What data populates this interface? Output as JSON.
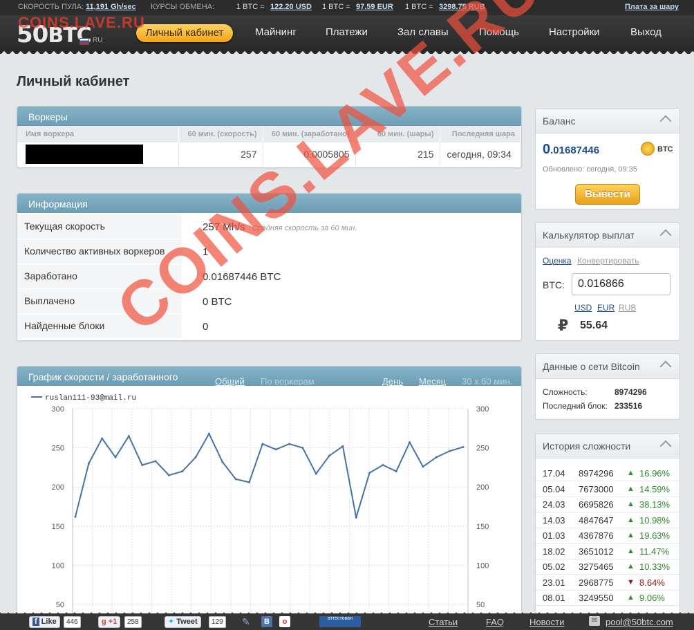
{
  "topbar": {
    "pool_speed_label": "СКОРОСТЬ ПУЛА:",
    "pool_speed_value": "11,191 Gh/sec",
    "rates_label": "КУРСЫ ОБМЕНА:",
    "rate1_prefix": "1 BTC =",
    "rate1_value": "122.20 USD",
    "rate2_prefix": "1 BTC =",
    "rate2_value": "97.59 EUR",
    "rate3_prefix": "1 BTC =",
    "rate3_value": "3298.75 RUB",
    "pay_per_share": "Плата за шару"
  },
  "header": {
    "logo_num": "50",
    "logo_text": "BTC",
    "lang": "RU",
    "nav": [
      "Личный кабинет",
      "Майнинг",
      "Платежи",
      "Зал славы",
      "Помощь",
      "Настройки",
      "Выход"
    ]
  },
  "watermark": {
    "top": "COINS.LAVE.RU",
    "diagonal": "COINS.LAVE.RU"
  },
  "page_title": "Личный кабинет",
  "workers": {
    "title": "Воркеры",
    "columns": [
      "Имя воркера",
      "60 мин. (скорость)",
      "60 мин. (заработано)",
      "60 мин. (шары)",
      "Последняя шара"
    ],
    "row": {
      "speed": "257",
      "earned": "0.0005805",
      "shares": "215",
      "last_share": "сегодня, 09:34"
    }
  },
  "info": {
    "title": "Информация",
    "rows": [
      {
        "label": "Текущая скорость",
        "value": "257 Mh/s",
        "note": "Средняя скорость за 60 мин."
      },
      {
        "label": "Количество активных воркеров",
        "value": "1"
      },
      {
        "label": "Заработано",
        "value": "0.01687446 BTC"
      },
      {
        "label": "Выплачено",
        "value": "0 BTC"
      },
      {
        "label": "Найденные блоки",
        "value": "0"
      }
    ]
  },
  "chart_panel": {
    "title": "График скорости / заработанного",
    "tab_total": "Общий",
    "tab_by_worker": "По воркерам",
    "tab_day": "День",
    "tab_month": "Месяц",
    "range": "30 x 60 мин."
  },
  "chart_data": {
    "type": "line",
    "series": [
      {
        "name": "ruslan111-93@mail.ru",
        "values": [
          162,
          230,
          262,
          238,
          265,
          228,
          233,
          215,
          220,
          238,
          268,
          232,
          210,
          206,
          255,
          248,
          255,
          250,
          217,
          240,
          252,
          161,
          218,
          228,
          220,
          257,
          226,
          238,
          246,
          251
        ]
      }
    ],
    "ylim": [
      50,
      300
    ],
    "yticks": [
      300,
      250,
      200,
      150,
      100,
      50
    ],
    "legend_position": "top-left",
    "grid": true,
    "line_color": "#4572a7"
  },
  "balance": {
    "title": "Баланс",
    "amount_int": "0",
    "amount_frac": ".01687446",
    "currency": "BTC",
    "updated": "Обновлено: сегодня, 09:35",
    "withdraw": "Вывести"
  },
  "calculator": {
    "title": "Калькулятор выплат",
    "tab_estimate": "Оценка",
    "tab_convert": "Конвертировать",
    "btc_label": "BTC:",
    "btc_value": "0.016866",
    "cur_usd": "USD",
    "cur_eur": "EUR",
    "cur_rub": "RUB",
    "rub_sign": "₽",
    "rub_value": "55.64"
  },
  "network": {
    "title": "Данные о сети Bitcoin",
    "difficulty_label": "Сложность:",
    "difficulty_value": "8974296",
    "last_block_label": "Последний блок:",
    "last_block_value": "233516"
  },
  "difficulty_history": {
    "title": "История сложности",
    "rows": [
      {
        "date": "17.04",
        "value": "8974296",
        "dir": "up",
        "pct": "16.96%"
      },
      {
        "date": "05.04",
        "value": "7673000",
        "dir": "up",
        "pct": "14.59%"
      },
      {
        "date": "24.03",
        "value": "6695826",
        "dir": "up",
        "pct": "38.13%"
      },
      {
        "date": "14.03",
        "value": "4847647",
        "dir": "up",
        "pct": "10.98%"
      },
      {
        "date": "01.03",
        "value": "4367876",
        "dir": "up",
        "pct": "19.63%"
      },
      {
        "date": "18.02",
        "value": "3651012",
        "dir": "up",
        "pct": "11.47%"
      },
      {
        "date": "05.02",
        "value": "3275465",
        "dir": "up",
        "pct": "10.33%"
      },
      {
        "date": "23.01",
        "value": "2968775",
        "dir": "down",
        "pct": "8.64%"
      },
      {
        "date": "08.01",
        "value": "3249550",
        "dir": "up",
        "pct": "9.06%"
      }
    ],
    "up_color": "#2e8b2e",
    "down_color": "#8b1a1a"
  },
  "footer": {
    "fb_like": "Like",
    "fb_count": "446",
    "gplus": "+1",
    "gplus_count": "258",
    "tweet": "Tweet",
    "tweet_count": "129",
    "vk": "B",
    "badge_text": "аттестован",
    "links": [
      "Статьи",
      "FAQ",
      "Новости"
    ],
    "email": "pool@50btc.com"
  }
}
